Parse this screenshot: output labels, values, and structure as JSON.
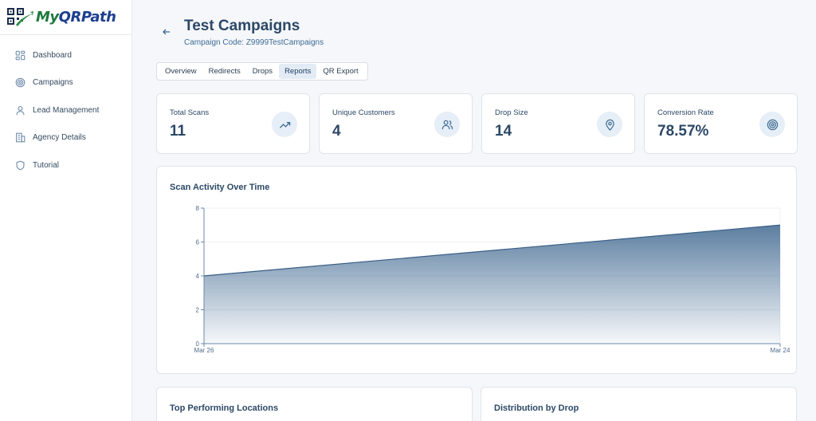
{
  "brand": {
    "part1": "My",
    "part2": "QRPath"
  },
  "sidebar": {
    "items": [
      {
        "label": "Dashboard",
        "icon": "grid-icon"
      },
      {
        "label": "Campaigns",
        "icon": "target-icon"
      },
      {
        "label": "Lead Management",
        "icon": "user-icon"
      },
      {
        "label": "Agency Details",
        "icon": "building-icon"
      },
      {
        "label": "Tutorial",
        "icon": "shield-icon"
      }
    ]
  },
  "header": {
    "title": "Test Campaigns",
    "subtitle": "Campaign Code: Z9999TestCampaigns"
  },
  "tabs": [
    {
      "label": "Overview",
      "active": false
    },
    {
      "label": "Redirects",
      "active": false
    },
    {
      "label": "Drops",
      "active": false
    },
    {
      "label": "Reports",
      "active": true
    },
    {
      "label": "QR Export",
      "active": false
    }
  ],
  "stats": [
    {
      "label": "Total Scans",
      "value": "11",
      "icon": "trending-up-icon"
    },
    {
      "label": "Unique Customers",
      "value": "4",
      "icon": "users-icon"
    },
    {
      "label": "Drop Size",
      "value": "14",
      "icon": "map-pin-icon"
    },
    {
      "label": "Conversion Rate",
      "value": "78.57%",
      "icon": "target-icon"
    }
  ],
  "chart_data": {
    "type": "area",
    "title": "Scan Activity Over Time",
    "x": [
      "Mar 26",
      "Mar 24"
    ],
    "series": [
      {
        "values": [
          4,
          7
        ]
      }
    ],
    "y_ticks": [
      0,
      2,
      4,
      6,
      8
    ],
    "ylim": [
      0,
      8
    ],
    "grid": true,
    "fill_color": "#4a7096"
  },
  "bottom": {
    "left_title": "Top Performing Locations",
    "right_title": "Distribution by Drop"
  },
  "colors": {
    "accent": "#2c4866",
    "icon_bg": "#e6eef7"
  }
}
